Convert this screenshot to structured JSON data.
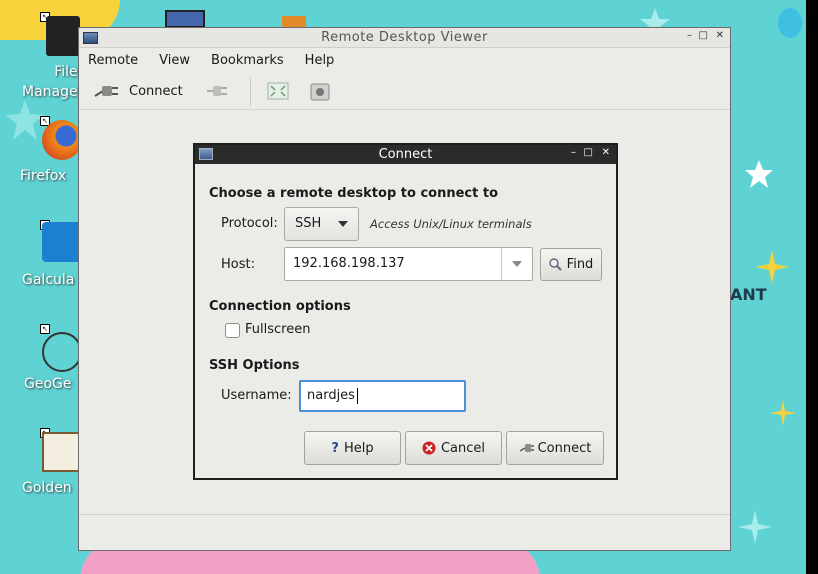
{
  "desktop": {
    "icons": [
      {
        "label": "File\nManage"
      },
      {
        "label": "Firefox"
      },
      {
        "label": "Galcula"
      },
      {
        "label": "GeoGe"
      },
      {
        "label": "Golden"
      }
    ],
    "wallpaper_text": "ANT"
  },
  "main_window": {
    "title": "Remote Desktop Viewer",
    "menu": [
      "Remote",
      "View",
      "Bookmarks",
      "Help"
    ],
    "toolbar": {
      "connect_label": "Connect"
    }
  },
  "dialog": {
    "title": "Connect",
    "heading": "Choose a remote desktop to connect to",
    "protocol_label": "Protocol:",
    "protocol_value": "SSH",
    "protocol_desc": "Access Unix/Linux terminals",
    "host_label": "Host:",
    "host_value": "192.168.198.137",
    "find_label": "Find",
    "connection_options_heading": "Connection options",
    "fullscreen_label": "Fullscreen",
    "fullscreen_checked": false,
    "ssh_options_heading": "SSH Options",
    "username_label": "Username:",
    "username_value": "nardjes",
    "help_label": "Help",
    "cancel_label": "Cancel",
    "connect_label": "Connect"
  },
  "colors": {
    "desktop_bg": "#5fd3d3",
    "dialog_titlebar": "#2b2b2b",
    "focus_border": "#4a90d9",
    "cancel_red": "#cc2222"
  }
}
